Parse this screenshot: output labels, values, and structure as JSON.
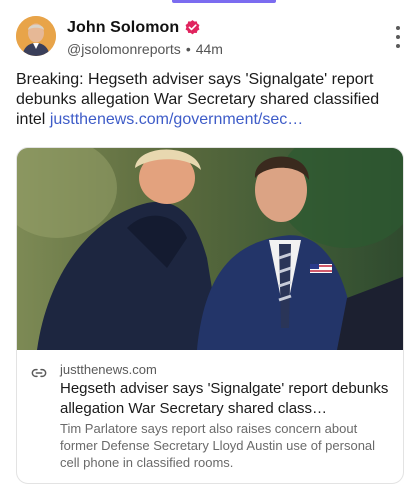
{
  "post": {
    "author": {
      "display_name": "John Solomon",
      "handle": "@jsolomonreports",
      "separator": "•",
      "age": "44m",
      "verified_color": "#e0245e"
    },
    "text": "Breaking: Hegseth adviser says 'Signalgate' report debunks allegation War Secretary shared classified intel",
    "link_text": "justthenews.com/government/sec…",
    "link_color": "#3e5cc8",
    "more_icon": "vertical-ellipsis-icon"
  },
  "link_card": {
    "domain": "justthenews.com",
    "title": "Hegseth adviser says 'Signalgate' report debunks allegation War Secretary shared class…",
    "description": "Tim Parlatore says report also raises concern about former Defense Secretary Lloyd Austin use of personal cell phone in classified rooms.",
    "link_icon": "link-icon"
  },
  "accent_color": "#7b6cf0"
}
